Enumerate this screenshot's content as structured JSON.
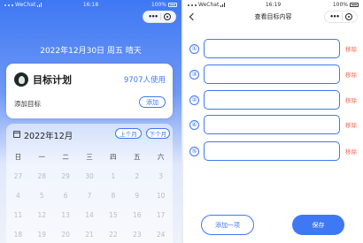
{
  "left": {
    "statusbar": {
      "carrier": "WeChat",
      "time": "16:18",
      "battery": "100%"
    },
    "date_line": "2022年12月30日 周五 晴天",
    "goal_card": {
      "title": "目标计划",
      "users": "9707人使用",
      "add_label": "添加目标",
      "add_button": "添加"
    },
    "calendar": {
      "month": "2022年12月",
      "prev_button": "上个月",
      "next_button": "下个月",
      "weekdays": [
        "日",
        "一",
        "二",
        "三",
        "四",
        "五",
        "六"
      ],
      "rows": [
        [
          "27",
          "28",
          "29",
          "30",
          "1",
          "2",
          "3"
        ],
        [
          "4",
          "5",
          "6",
          "7",
          "8",
          "9",
          "10"
        ],
        [
          "11",
          "12",
          "13",
          "14",
          "15",
          "16",
          "17"
        ],
        [
          "18",
          "19",
          "20",
          "21",
          "22",
          "23",
          "24"
        ]
      ]
    }
  },
  "right": {
    "statusbar": {
      "carrier": "WeChat",
      "time": "16:19",
      "battery": "100%"
    },
    "nav_title": "查看目标内容",
    "goals": [
      {
        "number": "①",
        "value": "",
        "remove": "移除"
      },
      {
        "number": "②",
        "value": "",
        "remove": "移除"
      },
      {
        "number": "③",
        "value": "",
        "remove": "移除"
      },
      {
        "number": "④",
        "value": "",
        "remove": "移除"
      },
      {
        "number": "⑤",
        "value": "",
        "remove": "移除"
      }
    ],
    "add_item_button": "添加一项",
    "save_button": "保存"
  },
  "colors": {
    "accent": "#3e78f4",
    "remove": "#f26a5b"
  }
}
